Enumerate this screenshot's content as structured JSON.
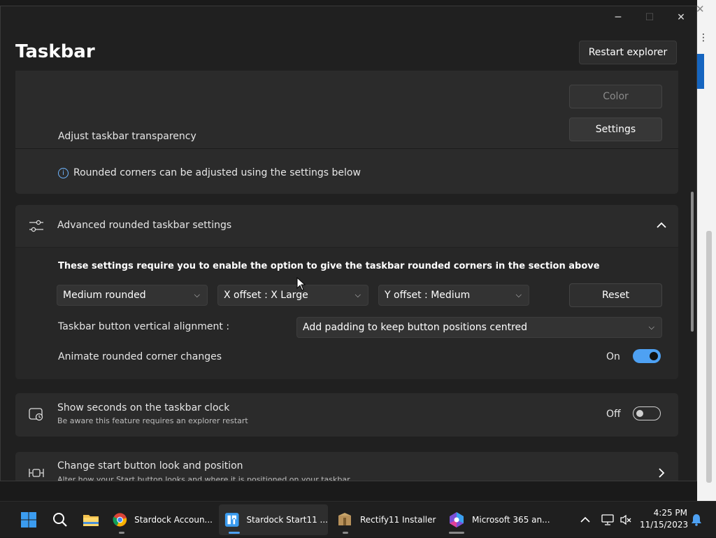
{
  "window": {
    "title": "Taskbar",
    "restart_label": "Restart explorer",
    "controls": {
      "minimize": "─",
      "maximize": "☐",
      "close": "✕"
    }
  },
  "top_card": {
    "color_label": "Color",
    "transparency_label": "Adjust taskbar transparency",
    "settings_label": "Settings",
    "info_text": "Rounded corners can be adjusted using the settings below"
  },
  "advanced": {
    "title": "Advanced rounded taskbar settings",
    "notice": "These settings require you to enable the option to give the taskbar rounded corners in the section above",
    "corner_select": "Medium rounded",
    "x_offset_select": "X offset : X Large",
    "y_offset_select": "Y offset : Medium",
    "reset_label": "Reset",
    "alignment_label": "Taskbar button vertical alignment :",
    "alignment_select": "Add padding to keep button positions centred",
    "animate_label": "Animate rounded corner changes",
    "animate_state": "On"
  },
  "seconds": {
    "title": "Show seconds on the taskbar clock",
    "subtitle": "Be aware this feature requires an explorer restart",
    "state": "Off"
  },
  "start_button": {
    "title": "Change start button look and position",
    "subtitle": "Alter how your Start button looks and where it is positioned on your taskbar."
  },
  "taskbar": {
    "apps": [
      {
        "label": "Stardock Accoun...",
        "icon": "chrome-icon"
      },
      {
        "label": "Stardock Start11 ...",
        "icon": "start11-icon"
      },
      {
        "label": "Rectify11 Installer",
        "icon": "installer-icon"
      },
      {
        "label": "Microsoft 365 an...",
        "icon": "m365-icon"
      }
    ],
    "time": "4:25 PM",
    "date": "11/15/2023"
  },
  "colors": {
    "accent": "#4ea1f3",
    "window_bg": "#202020",
    "card_bg": "#2b2b2b"
  }
}
